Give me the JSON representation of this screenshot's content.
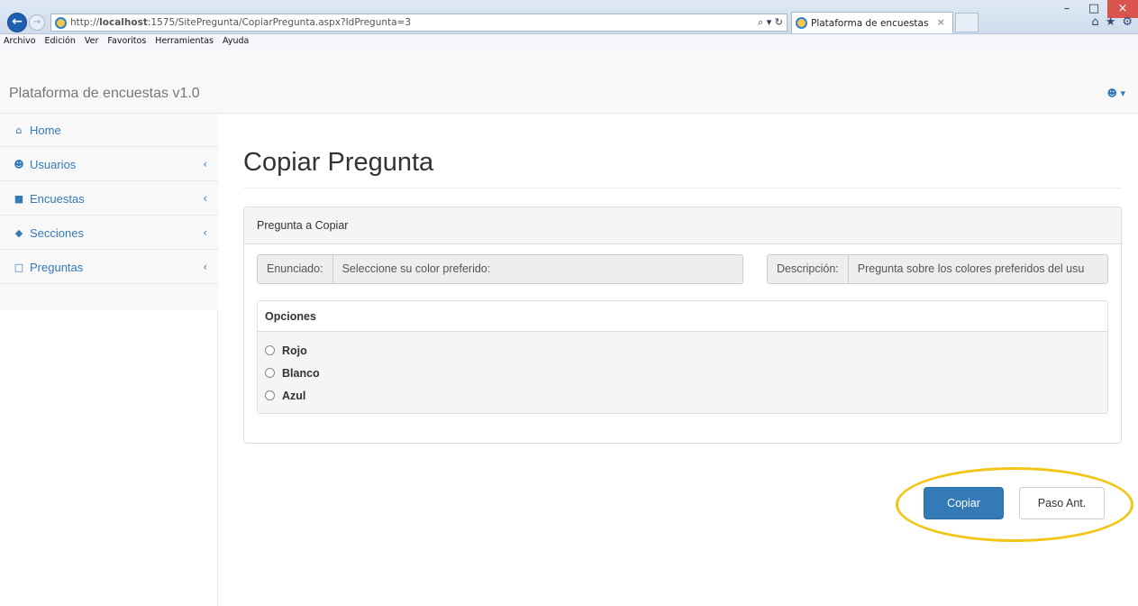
{
  "browser": {
    "url_prefix": "http://",
    "url_host": "localhost",
    "url_rest": ":1575/SitePregunta/CopiarPregunta.aspx?IdPregunta=3",
    "search_tools": "⌕ ▾ ↻",
    "tab_title": "Plataforma de encuestas",
    "tab_close": "×",
    "menu": [
      "Archivo",
      "Edición",
      "Ver",
      "Favoritos",
      "Herramientas",
      "Ayuda"
    ],
    "window_controls": {
      "minimize": "–",
      "maximize": "□",
      "close": "×"
    },
    "toolbar_icons": {
      "home": "⌂",
      "favorites": "★",
      "settings": "⚙"
    }
  },
  "navbar": {
    "brand": "Plataforma de encuestas v1.0",
    "user_menu": "☻ ▾"
  },
  "sidebar": {
    "items": [
      {
        "label": "Home",
        "icon": "⌂",
        "icon_name": "home-icon",
        "caret": ""
      },
      {
        "label": "Usuarios",
        "icon": "☻",
        "icon_name": "users-icon",
        "caret": "‹"
      },
      {
        "label": "Encuestas",
        "icon": "■",
        "icon_name": "bookmark-icon",
        "caret": "‹"
      },
      {
        "label": "Secciones",
        "icon": "◆",
        "icon_name": "tags-icon",
        "caret": "‹"
      },
      {
        "label": "Preguntas",
        "icon": "□",
        "icon_name": "bookmark-outline-icon",
        "caret": "‹"
      }
    ]
  },
  "main": {
    "title": "Copiar Pregunta",
    "panel_heading": "Pregunta a Copiar",
    "enunciado_label": "Enunciado:",
    "enunciado_value": "Seleccione su color preferido:",
    "descripcion_label": "Descripción:",
    "descripcion_value": "Pregunta sobre los colores preferidos del usu",
    "options_heading": "Opciones",
    "options": [
      "Rojo",
      "Blanco",
      "Azul"
    ],
    "copy_button": "Copiar",
    "prev_button": "Paso Ant."
  },
  "colors": {
    "primary": "#337ab7",
    "highlight": "#f2c518",
    "window_close": "#d9534f"
  }
}
